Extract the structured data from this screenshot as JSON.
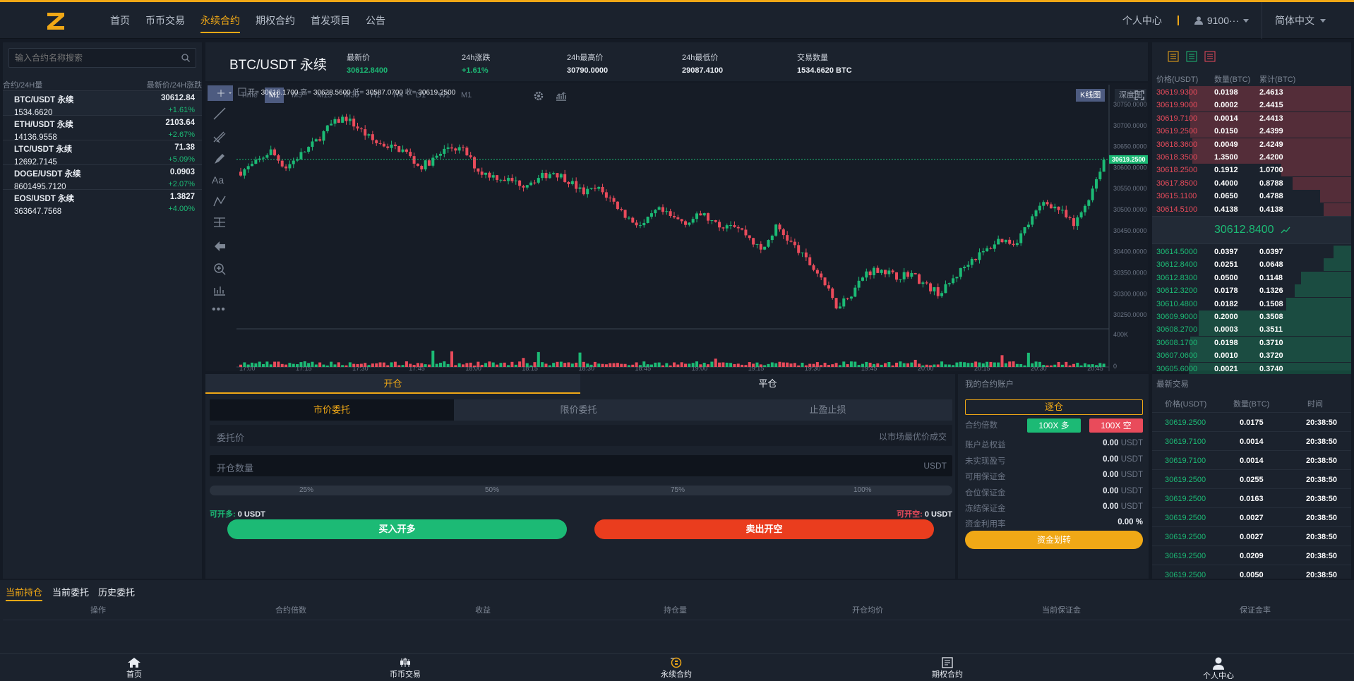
{
  "nav": {
    "items": [
      "首页",
      "币币交易",
      "永续合约",
      "期权合约",
      "首发项目",
      "公告"
    ],
    "active": 2,
    "personal": "个人中心",
    "user": "9100···",
    "lang": "简体中文"
  },
  "colors": {
    "accent": "#f0a816",
    "up": "#1cba75",
    "down": "#e94b5b"
  },
  "markets": {
    "search_placeholder": "输入合约名称搜索",
    "header_left": "合约/24H量",
    "header_right": "最新价/24H涨跌",
    "items": [
      {
        "name": "BTC/USDT 永续",
        "vol": "1534.6620",
        "price": "30612.84",
        "change": "+1.61%"
      },
      {
        "name": "ETH/USDT 永续",
        "vol": "14136.9558",
        "price": "2103.64",
        "change": "+2.67%"
      },
      {
        "name": "LTC/USDT 永续",
        "vol": "12692.7145",
        "price": "71.38",
        "change": "+5.09%"
      },
      {
        "name": "DOGE/USDT 永续",
        "vol": "8601495.7120",
        "price": "0.0903",
        "change": "+2.07%"
      },
      {
        "name": "EOS/USDT 永续",
        "vol": "363647.7568",
        "price": "1.3827",
        "change": "+4.00%"
      }
    ]
  },
  "ticker": {
    "symbol": "BTC/USDT 永续",
    "stats": [
      {
        "label": "最新价",
        "value": "30612.8400",
        "green": true
      },
      {
        "label": "24h涨跌",
        "value": "+1.61%",
        "green": true
      },
      {
        "label": "24h最高价",
        "value": "30790.0000",
        "green": false
      },
      {
        "label": "24h最低价",
        "value": "29087.4100",
        "green": false
      },
      {
        "label": "交易数量",
        "value": "1534.6620 BTC",
        "green": false
      }
    ]
  },
  "chart_toolbar": {
    "intervals": [
      "Time",
      "M1",
      "M5",
      "M15",
      "M30",
      "H1",
      "H4",
      "D1",
      "W1",
      "M1"
    ],
    "selected": 1,
    "kline": "K线图",
    "depth": "深度图"
  },
  "chart_data": {
    "type": "candlestick",
    "ohlc_label": {
      "o": "开=",
      "o_v": "30616.1700",
      "h": "高=",
      "h_v": "30628.5600",
      "l": "低=",
      "l_v": "30587.0700",
      "c": "收=",
      "c_v": "30619.2500"
    },
    "y_ticks": [
      "30750.0000",
      "30700.0000",
      "30650.0000",
      "30600.0000",
      "30550.0000",
      "30500.0000",
      "30450.0000",
      "30400.0000",
      "30350.0000",
      "30300.0000",
      "30250.0000"
    ],
    "ylim": [
      30230,
      30760
    ],
    "x_ticks": [
      "17:00",
      "17:15",
      "17:30",
      "17:45",
      "18:00",
      "18:15",
      "18:30",
      "18:45",
      "19:00",
      "19:15",
      "19:30",
      "19:45",
      "20:00",
      "20:15",
      "20:30",
      "20:45"
    ],
    "vol_ticks": [
      "400K",
      "0"
    ],
    "last_price": "30619.2500",
    "last_value": 30619.25,
    "close_path": [
      30590,
      30610,
      30640,
      30600,
      30630,
      30660,
      30700,
      30720,
      30690,
      30660,
      30650,
      30640,
      30600,
      30620,
      30650,
      30640,
      30590,
      30580,
      30570,
      30560,
      30575,
      30590,
      30570,
      30540,
      30550,
      30520,
      30480,
      30460,
      30500,
      30480,
      30470,
      30490,
      30460,
      30470,
      30440,
      30400,
      30460,
      30420,
      30380,
      30340,
      30270,
      30300,
      30350,
      30360,
      30340,
      30350,
      30320,
      30300,
      30340,
      30380,
      30400,
      30430,
      30420,
      30470,
      30520,
      30500,
      30460,
      30530,
      30619
    ]
  },
  "orderbook": {
    "headers": [
      "价格(USDT)",
      "数量(BTC)",
      "累计(BTC)"
    ],
    "asks": [
      [
        "30619.9300",
        "0.0198",
        "2.4613"
      ],
      [
        "30619.9000",
        "0.0002",
        "2.4415"
      ],
      [
        "30619.7100",
        "0.0014",
        "2.4413"
      ],
      [
        "30619.2500",
        "0.0150",
        "2.4399"
      ],
      [
        "30618.3600",
        "0.0049",
        "2.4249"
      ],
      [
        "30618.3500",
        "1.3500",
        "2.4200"
      ],
      [
        "30618.2500",
        "0.1912",
        "1.0700"
      ],
      [
        "30617.8500",
        "0.4000",
        "0.8788"
      ],
      [
        "30615.1100",
        "0.0650",
        "0.4788"
      ],
      [
        "30614.5100",
        "0.4138",
        "0.4138"
      ]
    ],
    "ask_depth": [
      1,
      0.99,
      0.99,
      0.99,
      0.98,
      0.98,
      0.43,
      0.36,
      0.19,
      0.17
    ],
    "mid": "30612.8400",
    "bids": [
      [
        "30614.5000",
        "0.0397",
        "0.0397"
      ],
      [
        "30612.8400",
        "0.0251",
        "0.0648"
      ],
      [
        "30612.8300",
        "0.0500",
        "0.1148"
      ],
      [
        "30612.3200",
        "0.0178",
        "0.1326"
      ],
      [
        "30610.4800",
        "0.0182",
        "0.1508"
      ],
      [
        "30609.9000",
        "0.2000",
        "0.3508"
      ],
      [
        "30608.2700",
        "0.0003",
        "0.3511"
      ],
      [
        "30608.1700",
        "0.0198",
        "0.3710"
      ],
      [
        "30607.0600",
        "0.0010",
        "0.3720"
      ],
      [
        "30605.6000",
        "0.0021",
        "0.3740"
      ]
    ],
    "bid_depth": [
      0.11,
      0.17,
      0.31,
      0.35,
      0.4,
      0.94,
      0.94,
      0.99,
      0.99,
      1
    ]
  },
  "trade": {
    "open": "开仓",
    "close": "平仓",
    "types": [
      "市价委托",
      "限价委托",
      "止盈止损"
    ],
    "price_label": "委托价",
    "price_hint": "以市场最优价成交",
    "qty_label": "开仓数量",
    "qty_unit": "USDT",
    "pcts": [
      "25%",
      "50%",
      "75%",
      "100%"
    ],
    "avail_long_label": "可开多:",
    "avail_long": "0 USDT",
    "avail_short_label": "可开空:",
    "avail_short": "0 USDT",
    "buy": "买入开多",
    "sell": "卖出开空"
  },
  "account": {
    "title": "我的合约账户",
    "mode": "逐仓",
    "leverage_label": "合约倍数",
    "lev_long": "100X 多",
    "lev_short": "100X 空",
    "rows": [
      [
        "账户总权益",
        "0.00",
        "USDT"
      ],
      [
        "未实现盈亏",
        "0.00",
        "USDT"
      ],
      [
        "可用保证金",
        "0.00",
        "USDT"
      ],
      [
        "仓位保证金",
        "0.00",
        "USDT"
      ],
      [
        "冻结保证金",
        "0.00",
        "USDT"
      ]
    ],
    "util_label": "资金利用率",
    "util": "0.00 %",
    "transfer": "资金划转"
  },
  "trades": {
    "title": "最新交易",
    "headers": [
      "价格(USDT)",
      "数量(BTC)",
      "时间"
    ],
    "rows": [
      [
        "30619.2500",
        "0.0175",
        "20:38:50"
      ],
      [
        "30619.7100",
        "0.0014",
        "20:38:50"
      ],
      [
        "30619.7100",
        "0.0014",
        "20:38:50"
      ],
      [
        "30619.2500",
        "0.0255",
        "20:38:50"
      ],
      [
        "30619.2500",
        "0.0163",
        "20:38:50"
      ],
      [
        "30619.2500",
        "0.0027",
        "20:38:50"
      ],
      [
        "30619.2500",
        "0.0027",
        "20:38:50"
      ],
      [
        "30619.2500",
        "0.0209",
        "20:38:50"
      ],
      [
        "30619.2500",
        "0.0050",
        "20:38:50"
      ]
    ]
  },
  "positions": {
    "tabs": [
      "当前持仓",
      "当前委托",
      "历史委托"
    ],
    "cols": [
      "操作",
      "合约倍数",
      "收益",
      "持仓量",
      "开仓均价",
      "当前保证金",
      "保证金率"
    ]
  },
  "tabbar": [
    "首页",
    "币币交易",
    "永续合约",
    "期权合约",
    "个人中心"
  ]
}
